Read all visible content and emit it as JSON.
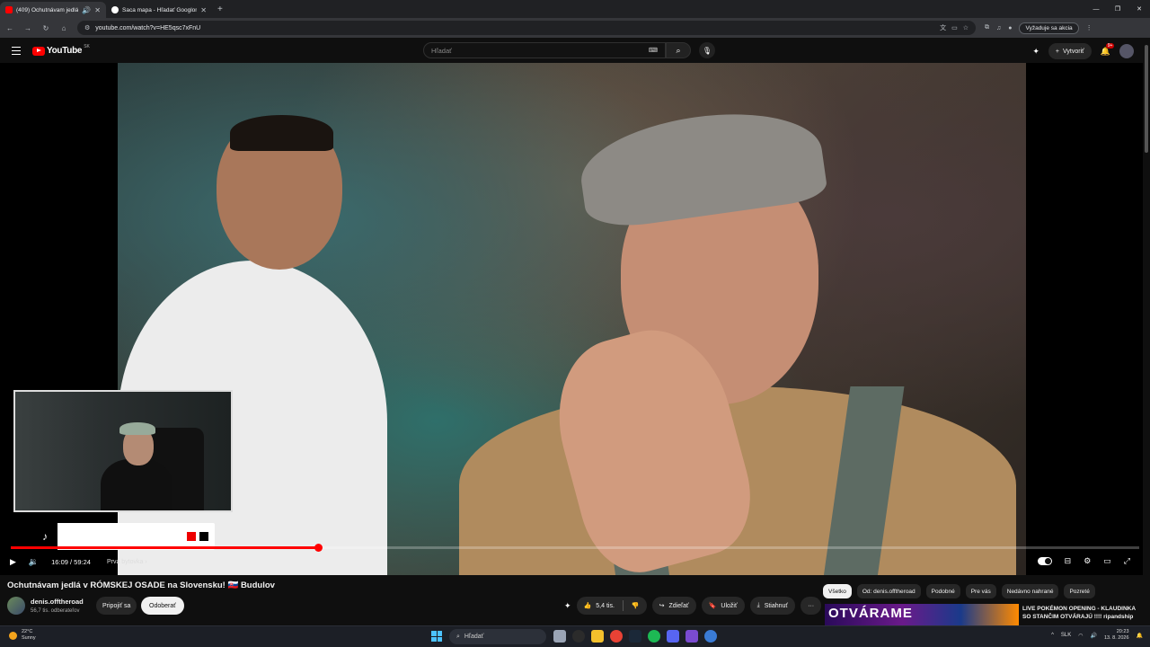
{
  "browser": {
    "tabs": [
      {
        "title": "(409) Ochutnávam jedlá v R",
        "active": true
      },
      {
        "title": "Šaca mapa - Hľadať Googlom",
        "active": false
      }
    ],
    "url": "youtube.com/watch?v=HE5qsc7xFnU",
    "action_label": "Vyžaduje sa akcia",
    "window_controls": [
      "—",
      "❐",
      "✕"
    ]
  },
  "youtube": {
    "logo_text": "YouTube",
    "logo_country": "SK",
    "search_placeholder": "Hľadať",
    "create_label": "Vytvoriť",
    "notif_count": "9+"
  },
  "player": {
    "time": "16:09 / 59:24",
    "chapter": "Prvá bytovka ›",
    "progress": 0.272
  },
  "video": {
    "title": "Ochutnávam jedlá v RÓMSKEJ OSADE na Slovensku! 🇸🇰 Budulov",
    "channel": "denis.offtheroad",
    "subscribers": "56,7 tis. odberateľov",
    "join_label": "Pripojiť sa",
    "unsubscribe_label": "Odoberať",
    "likes": "5,4 tis.",
    "share_label": "Zdieľať",
    "save_label": "Uložiť",
    "download_label": "Stiahnuť"
  },
  "sidebar": {
    "chips": [
      "Všetko",
      "Od: denis.offtheroad",
      "Podobné",
      "Pre vás",
      "Nedávno nahrané",
      "Pozreté"
    ],
    "rec_thumb_text": "OTVÁRAME",
    "rec_title": "LIVE POKÉMON OPENING - KLAUDINKA SO STANČIM OTVÁRAJÚ !!!! ripandship"
  },
  "taskbar": {
    "temp": "22°C",
    "weather": "Sunny",
    "search_label": "Hľadať",
    "lang": "SLK",
    "time": "20:23",
    "date": "13. 8. 2026"
  },
  "colors": {
    "accent": "#ff0000",
    "background": "#0f0f0f",
    "chip_active": "#f1f1f1"
  }
}
